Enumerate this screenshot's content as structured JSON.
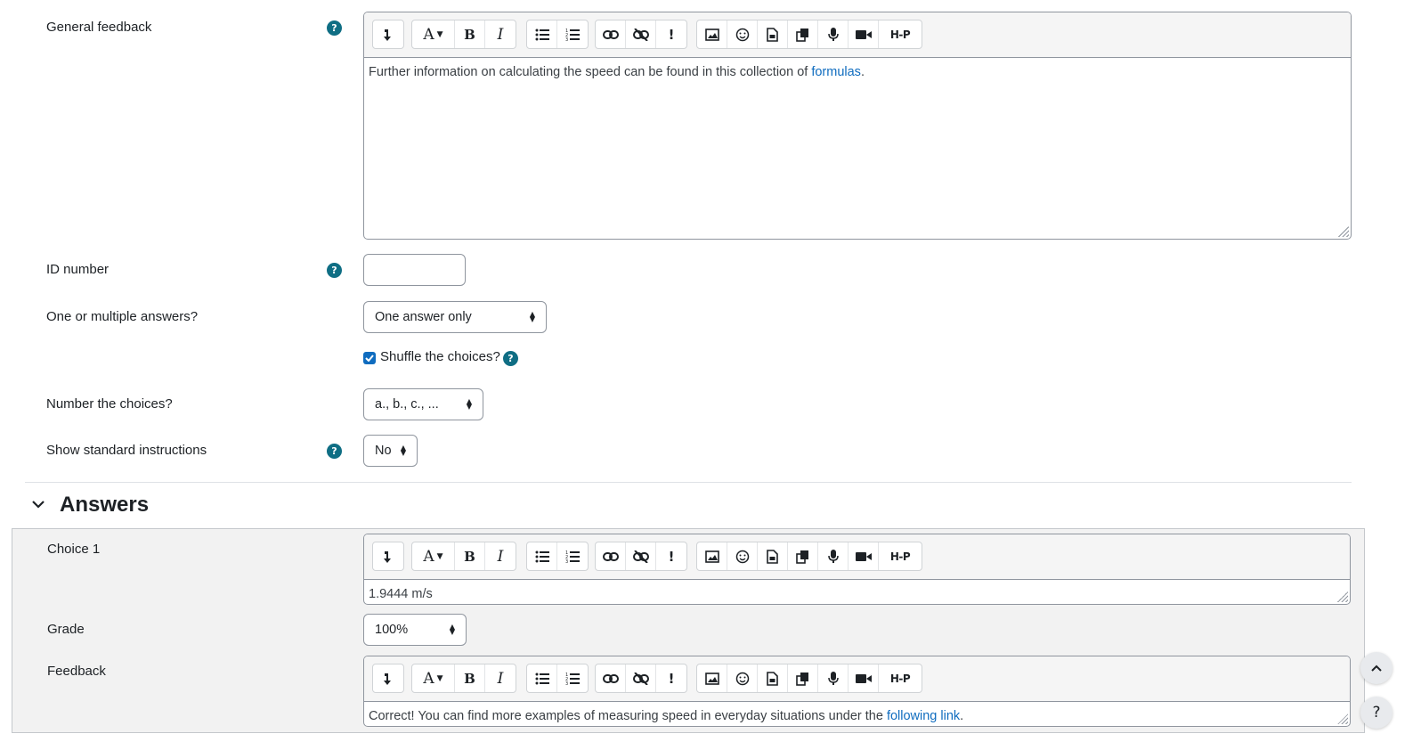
{
  "general_feedback": {
    "label": "General feedback",
    "help": "?",
    "text_before": "Further information on calculating the speed can be found in this collection of ",
    "link": "formulas",
    "text_after": "."
  },
  "id_number": {
    "label": "ID number",
    "help": "?",
    "value": ""
  },
  "single": {
    "label": "One or multiple answers?",
    "value": "One answer only"
  },
  "shuffle": {
    "label": "Shuffle the choices?",
    "checked": true,
    "help": "?"
  },
  "numbering": {
    "label": "Number the choices?",
    "value": "a., b., c., ..."
  },
  "instructions": {
    "label": "Show standard instructions",
    "help": "?",
    "value": "No"
  },
  "answers_section": {
    "title": "Answers"
  },
  "choice1": {
    "label": "Choice 1",
    "value": "1.9444 m/s"
  },
  "grade": {
    "label": "Grade",
    "value": "100%"
  },
  "feedback": {
    "label": "Feedback",
    "text_before": "Correct! You can find more examples of measuring speed in everyday situations under the ",
    "link": "following link",
    "text_after": "."
  },
  "toolbar": {
    "h5p_label": "H-P",
    "font_label": "A"
  },
  "floating": {
    "help_label": "?"
  },
  "colors": {
    "accent": "#0f6cbf",
    "help": "#0f6e84"
  }
}
